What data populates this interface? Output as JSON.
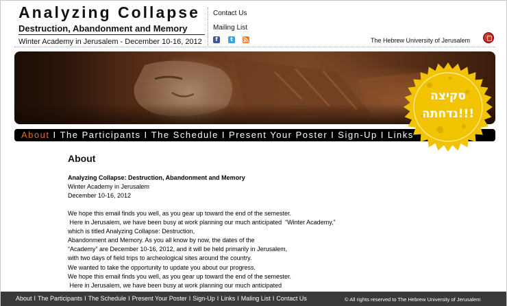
{
  "header": {
    "title": "Analyzing Collapse",
    "subtitle": "Destruction, Abandonment and Memory",
    "dates": "Winter Academy in Jerusalem - December 10-16, 2012",
    "contact_label": "Contact Us",
    "mailing_label": "Mailing List",
    "facebook_icon": "facebook-icon",
    "twitter_icon": "twitter-icon",
    "rss_icon": "rss-icon",
    "university": "The Hebrew University of Jerusalem"
  },
  "nav": {
    "items": [
      "About",
      "The Participants",
      "The Schedule",
      "Present Your Poster",
      "Sign-Up",
      "Links"
    ],
    "separator": "I",
    "active_color": "#e36b2a"
  },
  "stamp": {
    "line1": "סקיצה",
    "line2": "נדחתה!!!",
    "color": "#f2c300"
  },
  "content": {
    "heading": "About",
    "intro_title": "Analyzing Collapse: Destruction, Abandonment and Memory",
    "intro_line2": "Winter Academy in Jerusalem",
    "intro_line3": "December 10-16, 2012",
    "paragraph": [
      "We hope this email finds you well, as you gear up toward the end of the semester.",
      " Here in Jerusalem, we have been busy at work planning our much anticipated  “Winter Academy,”",
      "which is titled Analyzing Collapse: Destruction,",
      "Abandonment and Memory. As you all know by now, the dates of the",
      "“Academy” are December 10-16, 2012, and it will be held primarily in Jerusalem,",
      "with two days of field trips to archeological sites around the country.",
      "We wanted to take the opportunity to update you about our progress.",
      "We hope this email finds you well, as you gear up toward the end of the semester.",
      " Here in Jerusalem, we have been busy at work planning our much anticipated"
    ]
  },
  "footer": {
    "links": [
      "About",
      "The Participants",
      "The Schedule",
      "Present Your Poster",
      "Sign-Up",
      "Links",
      "Maling List",
      "Contact Us"
    ],
    "separator": "I",
    "copyright": "© All rights reserved to The Hebrew University of Jerusalem"
  }
}
